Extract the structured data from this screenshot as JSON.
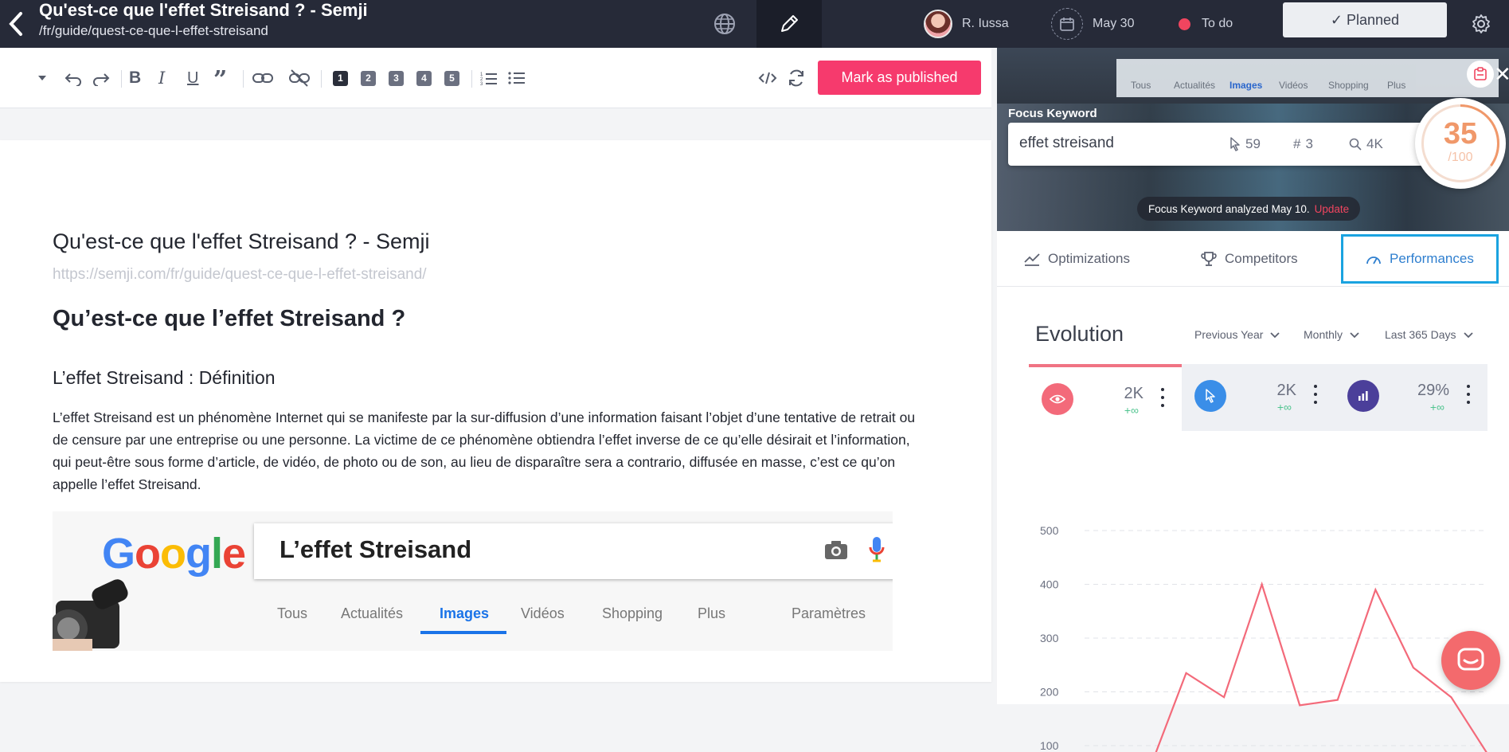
{
  "header": {
    "title": "Qu'est-ce que l'effet Streisand ? - Semji",
    "path": "/fr/guide/quest-ce-que-l-effet-streisand",
    "user_name": "R. Iussa",
    "date": "May 30",
    "status": "To do",
    "status_color": "#f0455f",
    "planned_label": "✓ Planned"
  },
  "toolbar": {
    "heading_levels": [
      "1",
      "2",
      "3",
      "4",
      "5"
    ],
    "publish_label": "Mark as published",
    "publish_color": "#f63a6d"
  },
  "document": {
    "meta_title": "Qu'est-ce que l'effet Streisand ? - Semji",
    "url": "https://semji.com/fr/guide/quest-ce-que-l-effet-streisand/",
    "h1": "Qu’est-ce que l’effet Streisand ?",
    "h2": "L’effet Streisand : Définition",
    "paragraph": "L’effet Streisand est un phénomène Internet qui se manifeste par la sur-diffusion d’une information faisant l’objet d’une tentative de retrait ou de censure par une entreprise ou une personne. La victime de ce phénomène obtiendra l’effet inverse de ce qu’elle désirait et l’information, qui peut-être sous forme d’article, de vidéo, de photo ou de son, au lieu de disparaître sera a contrario, diffusée en masse, c’est ce qu’on appelle l’effet Streisand.",
    "image": {
      "logo": "Google",
      "query": "L’effet Streisand",
      "tabs": [
        "Tous",
        "Actualités",
        "Images",
        "Vidéos",
        "Shopping",
        "Plus",
        "Paramètres"
      ],
      "active_tab": "Images"
    }
  },
  "focus": {
    "label": "Focus Keyword",
    "keyword": "effet streisand",
    "clicks": "59",
    "rank": "3",
    "volume": "4K",
    "score": "35",
    "score_max": "/100",
    "analyzed_text": "Focus Keyword analyzed May 10.",
    "update_label": "Update",
    "hero_tabs": [
      "Tous",
      "Actualités",
      "Images",
      "Vidéos",
      "Shopping",
      "Plus"
    ]
  },
  "panel_tabs": [
    {
      "label": "Optimizations",
      "icon": "trend-icon"
    },
    {
      "label": "Competitors",
      "icon": "trophy-icon"
    },
    {
      "label": "Performances",
      "icon": "gauge-icon",
      "active": true
    }
  ],
  "evolution": {
    "title": "Evolution",
    "filters": [
      "Previous Year",
      "Monthly",
      "Last 365 Days"
    ],
    "metrics": [
      {
        "value": "2K",
        "delta": "+∞",
        "icon": "eye-icon",
        "color": "#f36a7a"
      },
      {
        "value": "2K",
        "delta": "+∞",
        "icon": "cursor-icon",
        "color": "#3a8ee8"
      },
      {
        "value": "29%",
        "delta": "+∞",
        "icon": "bar-chart-icon",
        "color": "#4b3f9a"
      }
    ]
  },
  "chart_data": {
    "type": "line",
    "y_ticks": [
      "500",
      "400",
      "300",
      "200",
      "100"
    ],
    "ylim": [
      0,
      500
    ],
    "grid": true,
    "series": [
      {
        "color": "#f36a7a",
        "values": [
          50,
          235,
          190,
          400,
          175,
          185,
          390,
          245,
          190,
          80
        ]
      }
    ]
  }
}
